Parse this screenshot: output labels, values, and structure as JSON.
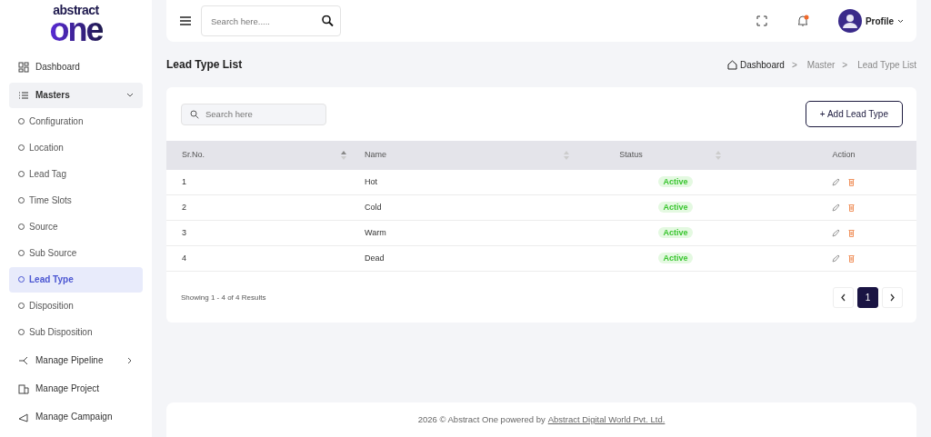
{
  "logo": {
    "top": "abstract",
    "main": "one"
  },
  "sidebar": {
    "items": [
      {
        "kind": "link",
        "label": "Dashboard"
      },
      {
        "kind": "group",
        "label": "Masters",
        "expanded": true,
        "children": [
          {
            "label": "Configuration",
            "selected": false
          },
          {
            "label": "Location",
            "selected": false
          },
          {
            "label": "Lead Tag",
            "selected": false
          },
          {
            "label": "Time Slots",
            "selected": false
          },
          {
            "label": "Source",
            "selected": false
          },
          {
            "label": "Sub Source",
            "selected": false
          },
          {
            "label": "Lead Type",
            "selected": true
          },
          {
            "label": "Disposition",
            "selected": false
          },
          {
            "label": "Sub Disposition",
            "selected": false
          }
        ]
      },
      {
        "kind": "group",
        "label": "Manage Pipeline",
        "expanded": false
      },
      {
        "kind": "link",
        "label": "Manage Project"
      },
      {
        "kind": "link",
        "label": "Manage Campaign"
      }
    ]
  },
  "topbar": {
    "search": {
      "placeholder": "Search here....."
    },
    "profile": "Profile"
  },
  "page_title": "Lead Type List",
  "breadcrumb": [
    {
      "kind": "link",
      "label": "Dashboard"
    },
    {
      "kind": "separator",
      "label": ">"
    },
    {
      "kind": "link",
      "label": "Master"
    },
    {
      "kind": "separator",
      "label": ">"
    },
    {
      "kind": "current",
      "label": "Lead Type List"
    }
  ],
  "toolbar": {
    "search": {
      "placeholder": "Search here"
    },
    "add_button": "+ Add Lead Type"
  },
  "table": {
    "columns": [
      {
        "label": "Sr.No.",
        "sortable": true
      },
      {
        "label": "Name",
        "sortable": true
      },
      {
        "label": "Status",
        "sortable": true
      },
      {
        "label": "Action",
        "sortable": false
      }
    ],
    "rows": [
      {
        "sr": "1",
        "name": "Hot",
        "status": "Active"
      },
      {
        "sr": "2",
        "name": "Cold",
        "status": "Active"
      },
      {
        "sr": "3",
        "name": "Warm",
        "status": "Active"
      },
      {
        "sr": "4",
        "name": "Dead",
        "status": "Active"
      }
    ]
  },
  "pagination": {
    "summary": "Showing 1 - 4 of 4 Results",
    "pages": [
      {
        "label": "1",
        "selected": true
      }
    ]
  },
  "footer": {
    "text": "2026 © Abstract One powered by",
    "link": "Abstract Digital World Pvt. Ltd."
  }
}
